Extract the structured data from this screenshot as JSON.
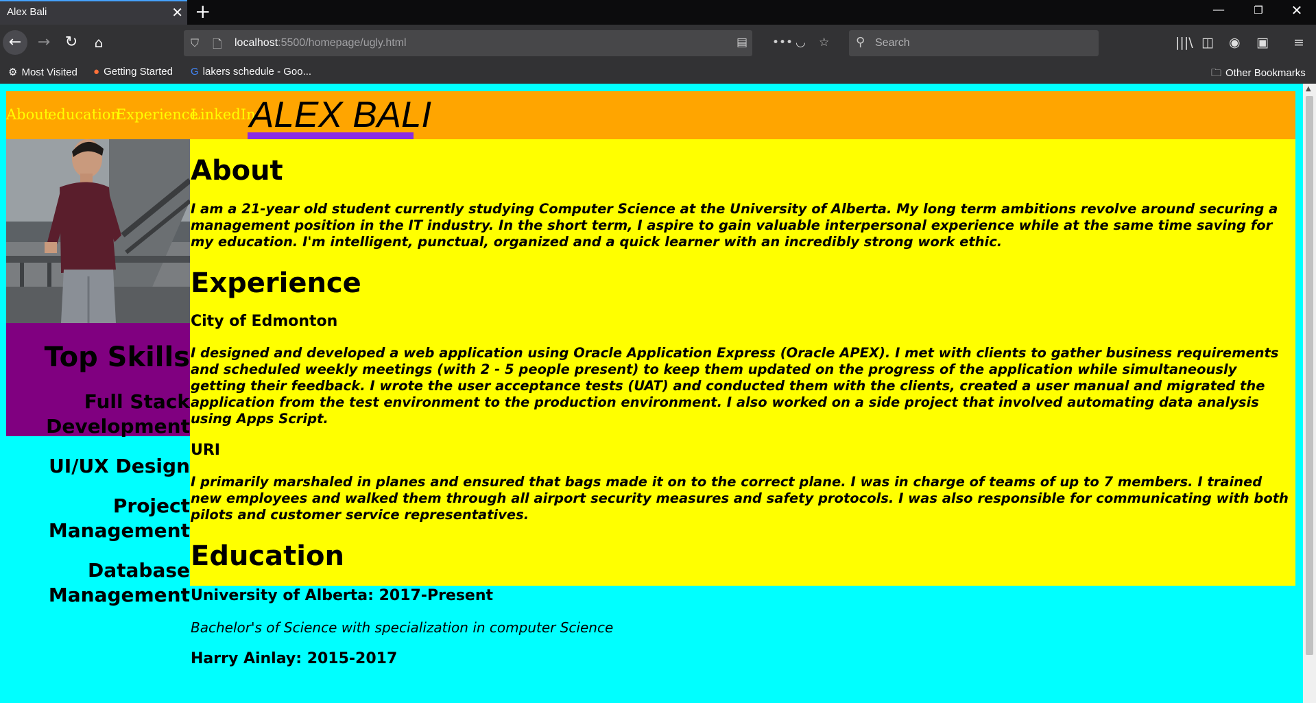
{
  "browser": {
    "tab_title": "Alex Bali",
    "url_host": "localhost",
    "url_rest": ":5500/homepage/ugly.html",
    "search_placeholder": "Search",
    "bookmarks": [
      "Most Visited",
      "Getting Started",
      "lakers schedule - Goo..."
    ],
    "other_bookmarks": "Other Bookmarks"
  },
  "header": {
    "nav": [
      "About",
      "education",
      "Experience",
      "LinkedIn"
    ],
    "title": "ALEX BALI"
  },
  "sidebar": {
    "heading": "Top Skills",
    "skills": [
      "Full Stack Development",
      "UI/UX Design",
      "Project Management",
      "Database Management"
    ]
  },
  "about": {
    "heading": "About",
    "text": "I am a 21-year old student currently studying Computer Science at the University of Alberta. My long term ambitions revolve around securing a management position in the IT industry. In the short term, I aspire to gain valuable interpersonal experience while at the same time saving for my education. I'm intelligent, punctual, organized and a quick learner with an incredibly strong work ethic."
  },
  "experience": {
    "heading": "Experience",
    "jobs": [
      {
        "title": "City of Edmonton",
        "text": "I designed and developed a web application using Oracle Application Express (Oracle APEX). I met with clients to gather business requirements and scheduled weekly meetings (with 2 - 5 people present) to keep them updated on the progress of the application while simultaneously getting their feedback. I wrote the user acceptance tests (UAT) and conducted them with the clients, created a user manual and migrated the application from the test environment to the production environment. I also worked on a side project that involved automating data analysis using Apps Script."
      },
      {
        "title": "URI",
        "text": "I primarily marshaled in planes and ensured that bags made it on to the correct plane. I was in charge of teams of up to 7 members. I trained new employees and walked them through all airport security measures and safety protocols. I was also responsible for communicating with both pilots and customer service representatives."
      }
    ]
  },
  "education": {
    "heading": "Education",
    "entries": [
      {
        "school": "University of Alberta: 2017-Present",
        "degree": "Bachelor's of Science with specialization in computer Science"
      },
      {
        "school": "Harry Ainlay: 2015-2017"
      }
    ]
  }
}
